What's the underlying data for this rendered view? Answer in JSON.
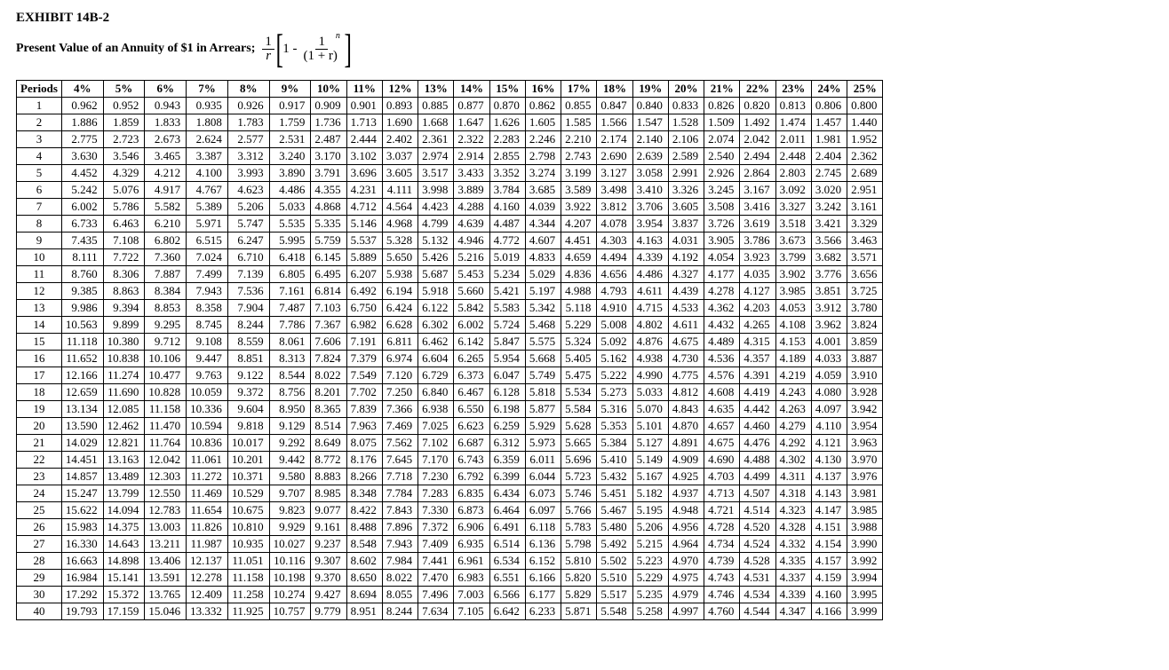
{
  "title": "EXHIBIT 14B-2",
  "subtitle": "Present Value of an Annuity of $1 in Arrears;",
  "formula": {
    "one_over_r_num": "1",
    "one_over_r_den": "r",
    "one_minus": "1 -",
    "inner_num": "1",
    "inner_den_base": "(1 + r)",
    "inner_den_exp": "n"
  },
  "period_header": "Periods",
  "rates": [
    "4%",
    "5%",
    "6%",
    "7%",
    "8%",
    "9%",
    "10%",
    "11%",
    "12%",
    "13%",
    "14%",
    "15%",
    "16%",
    "17%",
    "18%",
    "19%",
    "20%",
    "21%",
    "22%",
    "23%",
    "24%",
    "25%"
  ],
  "rows": [
    {
      "p": "1",
      "v": [
        "0.962",
        "0.952",
        "0.943",
        "0.935",
        "0.926",
        "0.917",
        "0.909",
        "0.901",
        "0.893",
        "0.885",
        "0.877",
        "0.870",
        "0.862",
        "0.855",
        "0.847",
        "0.840",
        "0.833",
        "0.826",
        "0.820",
        "0.813",
        "0.806",
        "0.800"
      ]
    },
    {
      "p": "2",
      "v": [
        "1.886",
        "1.859",
        "1.833",
        "1.808",
        "1.783",
        "1.759",
        "1.736",
        "1.713",
        "1.690",
        "1.668",
        "1.647",
        "1.626",
        "1.605",
        "1.585",
        "1.566",
        "1.547",
        "1.528",
        "1.509",
        "1.492",
        "1.474",
        "1.457",
        "1.440"
      ]
    },
    {
      "p": "3",
      "v": [
        "2.775",
        "2.723",
        "2.673",
        "2.624",
        "2.577",
        "2.531",
        "2.487",
        "2.444",
        "2.402",
        "2.361",
        "2.322",
        "2.283",
        "2.246",
        "2.210",
        "2.174",
        "2.140",
        "2.106",
        "2.074",
        "2.042",
        "2.011",
        "1.981",
        "1.952"
      ]
    },
    {
      "p": "4",
      "v": [
        "3.630",
        "3.546",
        "3.465",
        "3.387",
        "3.312",
        "3.240",
        "3.170",
        "3.102",
        "3.037",
        "2.974",
        "2.914",
        "2.855",
        "2.798",
        "2.743",
        "2.690",
        "2.639",
        "2.589",
        "2.540",
        "2.494",
        "2.448",
        "2.404",
        "2.362"
      ]
    },
    {
      "p": "5",
      "v": [
        "4.452",
        "4.329",
        "4.212",
        "4.100",
        "3.993",
        "3.890",
        "3.791",
        "3.696",
        "3.605",
        "3.517",
        "3.433",
        "3.352",
        "3.274",
        "3.199",
        "3.127",
        "3.058",
        "2.991",
        "2.926",
        "2.864",
        "2.803",
        "2.745",
        "2.689"
      ]
    },
    {
      "p": "6",
      "v": [
        "5.242",
        "5.076",
        "4.917",
        "4.767",
        "4.623",
        "4.486",
        "4.355",
        "4.231",
        "4.111",
        "3.998",
        "3.889",
        "3.784",
        "3.685",
        "3.589",
        "3.498",
        "3.410",
        "3.326",
        "3.245",
        "3.167",
        "3.092",
        "3.020",
        "2.951"
      ]
    },
    {
      "p": "7",
      "v": [
        "6.002",
        "5.786",
        "5.582",
        "5.389",
        "5.206",
        "5.033",
        "4.868",
        "4.712",
        "4.564",
        "4.423",
        "4.288",
        "4.160",
        "4.039",
        "3.922",
        "3.812",
        "3.706",
        "3.605",
        "3.508",
        "3.416",
        "3.327",
        "3.242",
        "3.161"
      ]
    },
    {
      "p": "8",
      "v": [
        "6.733",
        "6.463",
        "6.210",
        "5.971",
        "5.747",
        "5.535",
        "5.335",
        "5.146",
        "4.968",
        "4.799",
        "4.639",
        "4.487",
        "4.344",
        "4.207",
        "4.078",
        "3.954",
        "3.837",
        "3.726",
        "3.619",
        "3.518",
        "3.421",
        "3.329"
      ]
    },
    {
      "p": "9",
      "v": [
        "7.435",
        "7.108",
        "6.802",
        "6.515",
        "6.247",
        "5.995",
        "5.759",
        "5.537",
        "5.328",
        "5.132",
        "4.946",
        "4.772",
        "4.607",
        "4.451",
        "4.303",
        "4.163",
        "4.031",
        "3.905",
        "3.786",
        "3.673",
        "3.566",
        "3.463"
      ]
    },
    {
      "p": "10",
      "v": [
        "8.111",
        "7.722",
        "7.360",
        "7.024",
        "6.710",
        "6.418",
        "6.145",
        "5.889",
        "5.650",
        "5.426",
        "5.216",
        "5.019",
        "4.833",
        "4.659",
        "4.494",
        "4.339",
        "4.192",
        "4.054",
        "3.923",
        "3.799",
        "3.682",
        "3.571"
      ]
    },
    {
      "p": "11",
      "v": [
        "8.760",
        "8.306",
        "7.887",
        "7.499",
        "7.139",
        "6.805",
        "6.495",
        "6.207",
        "5.938",
        "5.687",
        "5.453",
        "5.234",
        "5.029",
        "4.836",
        "4.656",
        "4.486",
        "4.327",
        "4.177",
        "4.035",
        "3.902",
        "3.776",
        "3.656"
      ]
    },
    {
      "p": "12",
      "v": [
        "9.385",
        "8.863",
        "8.384",
        "7.943",
        "7.536",
        "7.161",
        "6.814",
        "6.492",
        "6.194",
        "5.918",
        "5.660",
        "5.421",
        "5.197",
        "4.988",
        "4.793",
        "4.611",
        "4.439",
        "4.278",
        "4.127",
        "3.985",
        "3.851",
        "3.725"
      ]
    },
    {
      "p": "13",
      "v": [
        "9.986",
        "9.394",
        "8.853",
        "8.358",
        "7.904",
        "7.487",
        "7.103",
        "6.750",
        "6.424",
        "6.122",
        "5.842",
        "5.583",
        "5.342",
        "5.118",
        "4.910",
        "4.715",
        "4.533",
        "4.362",
        "4.203",
        "4.053",
        "3.912",
        "3.780"
      ]
    },
    {
      "p": "14",
      "v": [
        "10.563",
        "9.899",
        "9.295",
        "8.745",
        "8.244",
        "7.786",
        "7.367",
        "6.982",
        "6.628",
        "6.302",
        "6.002",
        "5.724",
        "5.468",
        "5.229",
        "5.008",
        "4.802",
        "4.611",
        "4.432",
        "4.265",
        "4.108",
        "3.962",
        "3.824"
      ]
    },
    {
      "p": "15",
      "v": [
        "11.118",
        "10.380",
        "9.712",
        "9.108",
        "8.559",
        "8.061",
        "7.606",
        "7.191",
        "6.811",
        "6.462",
        "6.142",
        "5.847",
        "5.575",
        "5.324",
        "5.092",
        "4.876",
        "4.675",
        "4.489",
        "4.315",
        "4.153",
        "4.001",
        "3.859"
      ]
    },
    {
      "p": "16",
      "v": [
        "11.652",
        "10.838",
        "10.106",
        "9.447",
        "8.851",
        "8.313",
        "7.824",
        "7.379",
        "6.974",
        "6.604",
        "6.265",
        "5.954",
        "5.668",
        "5.405",
        "5.162",
        "4.938",
        "4.730",
        "4.536",
        "4.357",
        "4.189",
        "4.033",
        "3.887"
      ]
    },
    {
      "p": "17",
      "v": [
        "12.166",
        "11.274",
        "10.477",
        "9.763",
        "9.122",
        "8.544",
        "8.022",
        "7.549",
        "7.120",
        "6.729",
        "6.373",
        "6.047",
        "5.749",
        "5.475",
        "5.222",
        "4.990",
        "4.775",
        "4.576",
        "4.391",
        "4.219",
        "4.059",
        "3.910"
      ]
    },
    {
      "p": "18",
      "v": [
        "12.659",
        "11.690",
        "10.828",
        "10.059",
        "9.372",
        "8.756",
        "8.201",
        "7.702",
        "7.250",
        "6.840",
        "6.467",
        "6.128",
        "5.818",
        "5.534",
        "5.273",
        "5.033",
        "4.812",
        "4.608",
        "4.419",
        "4.243",
        "4.080",
        "3.928"
      ]
    },
    {
      "p": "19",
      "v": [
        "13.134",
        "12.085",
        "11.158",
        "10.336",
        "9.604",
        "8.950",
        "8.365",
        "7.839",
        "7.366",
        "6.938",
        "6.550",
        "6.198",
        "5.877",
        "5.584",
        "5.316",
        "5.070",
        "4.843",
        "4.635",
        "4.442",
        "4.263",
        "4.097",
        "3.942"
      ]
    },
    {
      "p": "20",
      "v": [
        "13.590",
        "12.462",
        "11.470",
        "10.594",
        "9.818",
        "9.129",
        "8.514",
        "7.963",
        "7.469",
        "7.025",
        "6.623",
        "6.259",
        "5.929",
        "5.628",
        "5.353",
        "5.101",
        "4.870",
        "4.657",
        "4.460",
        "4.279",
        "4.110",
        "3.954"
      ]
    },
    {
      "p": "21",
      "v": [
        "14.029",
        "12.821",
        "11.764",
        "10.836",
        "10.017",
        "9.292",
        "8.649",
        "8.075",
        "7.562",
        "7.102",
        "6.687",
        "6.312",
        "5.973",
        "5.665",
        "5.384",
        "5.127",
        "4.891",
        "4.675",
        "4.476",
        "4.292",
        "4.121",
        "3.963"
      ]
    },
    {
      "p": "22",
      "v": [
        "14.451",
        "13.163",
        "12.042",
        "11.061",
        "10.201",
        "9.442",
        "8.772",
        "8.176",
        "7.645",
        "7.170",
        "6.743",
        "6.359",
        "6.011",
        "5.696",
        "5.410",
        "5.149",
        "4.909",
        "4.690",
        "4.488",
        "4.302",
        "4.130",
        "3.970"
      ]
    },
    {
      "p": "23",
      "v": [
        "14.857",
        "13.489",
        "12.303",
        "11.272",
        "10.371",
        "9.580",
        "8.883",
        "8.266",
        "7.718",
        "7.230",
        "6.792",
        "6.399",
        "6.044",
        "5.723",
        "5.432",
        "5.167",
        "4.925",
        "4.703",
        "4.499",
        "4.311",
        "4.137",
        "3.976"
      ]
    },
    {
      "p": "24",
      "v": [
        "15.247",
        "13.799",
        "12.550",
        "11.469",
        "10.529",
        "9.707",
        "8.985",
        "8.348",
        "7.784",
        "7.283",
        "6.835",
        "6.434",
        "6.073",
        "5.746",
        "5.451",
        "5.182",
        "4.937",
        "4.713",
        "4.507",
        "4.318",
        "4.143",
        "3.981"
      ]
    },
    {
      "p": "25",
      "v": [
        "15.622",
        "14.094",
        "12.783",
        "11.654",
        "10.675",
        "9.823",
        "9.077",
        "8.422",
        "7.843",
        "7.330",
        "6.873",
        "6.464",
        "6.097",
        "5.766",
        "5.467",
        "5.195",
        "4.948",
        "4.721",
        "4.514",
        "4.323",
        "4.147",
        "3.985"
      ]
    },
    {
      "p": "26",
      "v": [
        "15.983",
        "14.375",
        "13.003",
        "11.826",
        "10.810",
        "9.929",
        "9.161",
        "8.488",
        "7.896",
        "7.372",
        "6.906",
        "6.491",
        "6.118",
        "5.783",
        "5.480",
        "5.206",
        "4.956",
        "4.728",
        "4.520",
        "4.328",
        "4.151",
        "3.988"
      ]
    },
    {
      "p": "27",
      "v": [
        "16.330",
        "14.643",
        "13.211",
        "11.987",
        "10.935",
        "10.027",
        "9.237",
        "8.548",
        "7.943",
        "7.409",
        "6.935",
        "6.514",
        "6.136",
        "5.798",
        "5.492",
        "5.215",
        "4.964",
        "4.734",
        "4.524",
        "4.332",
        "4.154",
        "3.990"
      ]
    },
    {
      "p": "28",
      "v": [
        "16.663",
        "14.898",
        "13.406",
        "12.137",
        "11.051",
        "10.116",
        "9.307",
        "8.602",
        "7.984",
        "7.441",
        "6.961",
        "6.534",
        "6.152",
        "5.810",
        "5.502",
        "5.223",
        "4.970",
        "4.739",
        "4.528",
        "4.335",
        "4.157",
        "3.992"
      ]
    },
    {
      "p": "29",
      "v": [
        "16.984",
        "15.141",
        "13.591",
        "12.278",
        "11.158",
        "10.198",
        "9.370",
        "8.650",
        "8.022",
        "7.470",
        "6.983",
        "6.551",
        "6.166",
        "5.820",
        "5.510",
        "5.229",
        "4.975",
        "4.743",
        "4.531",
        "4.337",
        "4.159",
        "3.994"
      ]
    },
    {
      "p": "30",
      "v": [
        "17.292",
        "15.372",
        "13.765",
        "12.409",
        "11.258",
        "10.274",
        "9.427",
        "8.694",
        "8.055",
        "7.496",
        "7.003",
        "6.566",
        "6.177",
        "5.829",
        "5.517",
        "5.235",
        "4.979",
        "4.746",
        "4.534",
        "4.339",
        "4.160",
        "3.995"
      ]
    },
    {
      "p": "40",
      "v": [
        "19.793",
        "17.159",
        "15.046",
        "13.332",
        "11.925",
        "10.757",
        "9.779",
        "8.951",
        "8.244",
        "7.634",
        "7.105",
        "6.642",
        "6.233",
        "5.871",
        "5.548",
        "5.258",
        "4.997",
        "4.760",
        "4.544",
        "4.347",
        "4.166",
        "3.999"
      ]
    }
  ]
}
